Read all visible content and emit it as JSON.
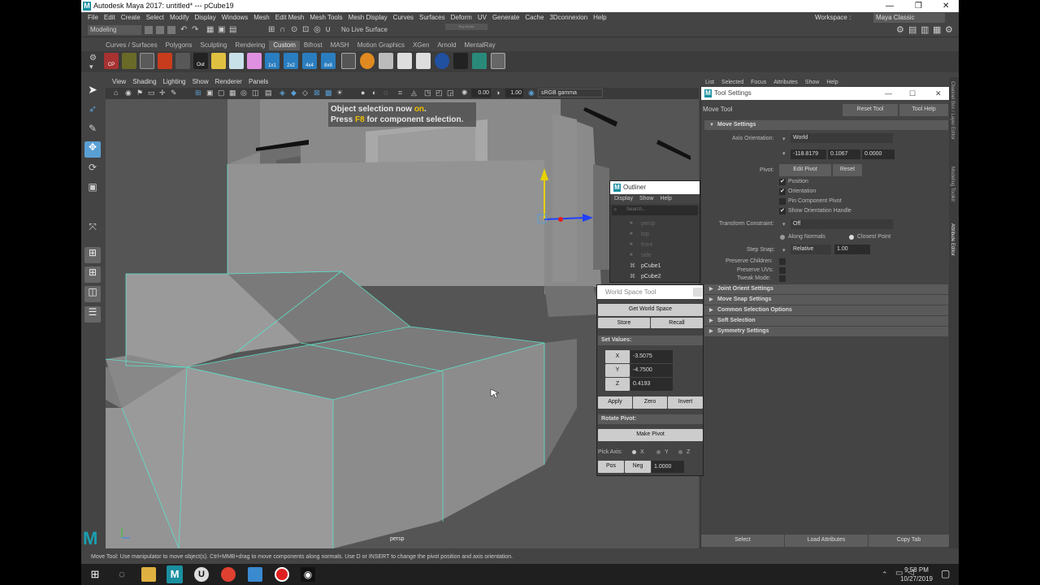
{
  "window": {
    "title": "Autodesk Maya 2017: untitled*   ---   pCube19",
    "controls": [
      "—",
      "❐",
      "✕"
    ]
  },
  "menubar": [
    "File",
    "Edit",
    "Create",
    "Select",
    "Modify",
    "Display",
    "Windows",
    "Mesh",
    "Edit Mesh",
    "Mesh Tools",
    "Mesh Display",
    "Curves",
    "Surfaces",
    "Deform",
    "UV",
    "Generate",
    "Cache",
    "3Dconnexion",
    "Help"
  ],
  "workspace": {
    "label": "Workspace :",
    "value": "Maya Classic"
  },
  "statusline": {
    "mode": "Modeling",
    "live_surface": "No Live Surface",
    "user": "Roy Alrawi"
  },
  "shelf_tabs": [
    "Curves / Surfaces",
    "Polygons",
    "Sculpting",
    "Rendering",
    "Custom",
    "Bifrost",
    "MASH",
    "Motion Graphics",
    "XGen",
    "Arnold",
    "MentalRay"
  ],
  "shelf_active": "Custom",
  "shelf_icon_labels": {
    "cp": "CP",
    "out": "Out",
    "a": "1x1",
    "b": "2x2",
    "c": "4x4",
    "d": "8x8"
  },
  "viewport": {
    "menu": [
      "View",
      "Shading",
      "Lighting",
      "Show",
      "Renderer",
      "Panels"
    ],
    "field1": "0.00",
    "field2": "1.00",
    "colorspace": "sRGB gamma",
    "hud_line1_a": "Object selection now ",
    "hud_line1_b": "on",
    "hud_line1_c": ".",
    "hud_line2_a": "Press ",
    "hud_line2_b": "F8",
    "hud_line2_c": " for component selection.",
    "camera": "persp"
  },
  "ae_menu": [
    "List",
    "Selected",
    "Focus",
    "Attributes",
    "Show",
    "Help"
  ],
  "tool_settings": {
    "title": "Tool Settings",
    "tool_name": "Move Tool",
    "reset_tool": "Reset Tool",
    "tool_help": "Tool Help",
    "section": "Move Settings",
    "axis_orientation_label": "Axis Orientation:",
    "axis_orientation_value": "World",
    "coords": [
      "-118.8179",
      "0.1067",
      "0.0000"
    ],
    "pivot_label": "Pivot:",
    "edit_pivot": "Edit Pivot",
    "reset": "Reset",
    "pivot_options": [
      {
        "label": "Position",
        "checked": true
      },
      {
        "label": "Orientation",
        "checked": true
      },
      {
        "label": "Pin Component Pivot",
        "checked": false
      },
      {
        "label": "Show Orientation Handle",
        "checked": true
      }
    ],
    "transform_constraint_label": "Transform Constraint:",
    "transform_constraint_value": "Off",
    "along_normals": "Along Normals",
    "closest_point": "Closest Point",
    "step_snap_label": "Step Snap:",
    "step_snap_mode": "Relative",
    "step_snap_value": "1.00",
    "preserve_children": "Preserve Children:",
    "preserve_uvs": "Preserve UVs:",
    "tweak_mode": "Tweak Mode:",
    "collapsed_sections": [
      "Joint Orient Settings",
      "Move Snap Settings",
      "Common Selection Options",
      "Soft Selection",
      "Symmetry Settings"
    ],
    "bottom_buttons": [
      "Select",
      "Load Attributes",
      "Copy Tab"
    ]
  },
  "side_tabs": [
    "Channel Box / Layer Editor",
    "Modeling Toolkit",
    "Attribute Editor"
  ],
  "outliner": {
    "title": "Outliner",
    "menu": [
      "Display",
      "Show",
      "Help"
    ],
    "search_placeholder": "Search...",
    "items": [
      {
        "name": "persp",
        "dim": true
      },
      {
        "name": "top",
        "dim": true
      },
      {
        "name": "front",
        "dim": true
      },
      {
        "name": "side",
        "dim": true
      },
      {
        "name": "pCube1",
        "dim": false
      },
      {
        "name": "pCube2",
        "dim": false
      }
    ]
  },
  "world_space_tool": {
    "title": "World Space Tool",
    "get_world_space": "Get World Space",
    "store": "Store",
    "recall": "Recall",
    "set_values": "Set Values:",
    "x_label": "X",
    "x_value": "-3.5075",
    "y_label": "Y",
    "y_value": "-4.7500",
    "z_label": "Z",
    "z_value": "0.4193",
    "apply": "Apply",
    "zero": "Zero",
    "invert": "Invert",
    "rotate_pivot": "Rotate Pivot:",
    "make_pivot": "Make Pivot",
    "pick_axis": "Pick Axis:",
    "axes": [
      "X",
      "Y",
      "Z"
    ],
    "pos": "Pos",
    "neg": "Neg",
    "amount": "1.0000"
  },
  "helpline": "Move Tool: Use manipulator to move object(s). Ctrl+MMB+drag to move components along normals. Use D or INSERT to change the pivot position and axis orientation.",
  "taskbar": {
    "time": "9:58 PM",
    "date": "10/27/2019"
  },
  "colors": {
    "accent": "#5a9fd4",
    "selection_edge": "#5ee0c8",
    "hud_highlight": "#f0c000"
  }
}
